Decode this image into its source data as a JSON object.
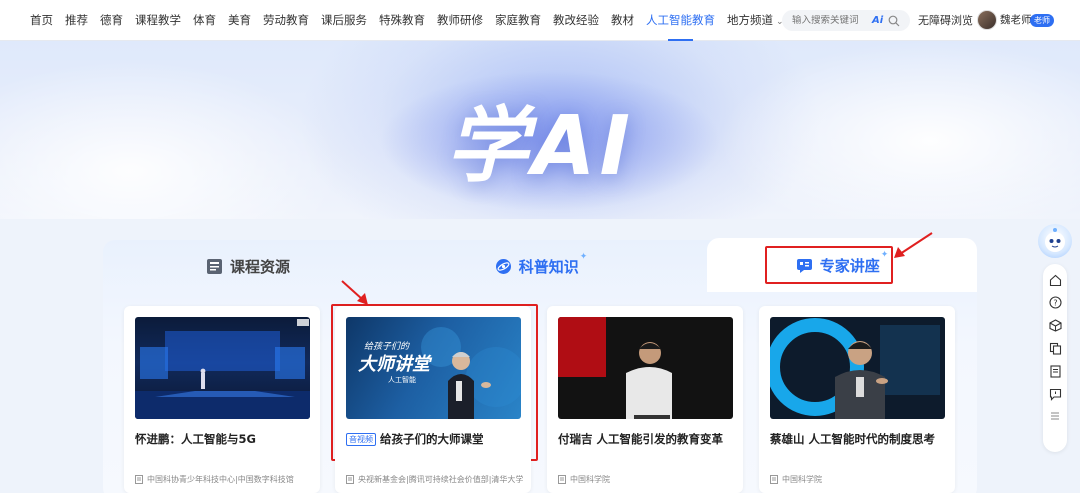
{
  "nav": {
    "items": [
      "首页",
      "推荐",
      "德育",
      "课程教学",
      "体育",
      "美育",
      "劳动教育",
      "课后服务",
      "特殊教育",
      "教师研修",
      "家庭教育",
      "教改经验",
      "教材",
      "人工智能教育",
      "地方频道"
    ],
    "active_index": 13,
    "search_placeholder": "输入搜索关键词",
    "search_ai_label": "Ai",
    "accessible_label": "无障碍浏览",
    "user_name": "魏老师",
    "user_badge": "老师"
  },
  "hero": {
    "title": "学AI"
  },
  "tabs": [
    {
      "label": "课程资源",
      "icon": "book-icon",
      "selected": false
    },
    {
      "label": "科普知识",
      "icon": "science-icon",
      "selected": false
    },
    {
      "label": "专家讲座",
      "icon": "lecture-icon",
      "selected": true
    }
  ],
  "cards": [
    {
      "title": "怀进鹏：人工智能与5G",
      "video_tag": "",
      "source": "中国科协青少年科技中心|中国数字科技馆",
      "thumb": "stage-event"
    },
    {
      "title": "给孩子们的大师课堂",
      "video_tag": "音视频",
      "source": "央视新基金会|腾讯可持续社会价值部|清华大学",
      "thumb": "master-class",
      "thumb_text": "给孩子们的",
      "thumb_text2": "大师讲堂",
      "thumb_text3": "人工智能"
    },
    {
      "title": "付瑞吉 人工智能引发的教育变革",
      "video_tag": "",
      "source": "中国科学院",
      "thumb": "speaker-dark"
    },
    {
      "title": "蔡雄山 人工智能时代的制度思考",
      "video_tag": "",
      "source": "中国科学院",
      "thumb": "speaker-blue"
    }
  ],
  "rail_icons": [
    "home-icon",
    "help-icon",
    "cube-icon",
    "copy-icon",
    "document-icon",
    "feedback-icon",
    "list-icon"
  ],
  "colors": {
    "accent": "#2e6ff2",
    "highlight": "#e02020"
  }
}
